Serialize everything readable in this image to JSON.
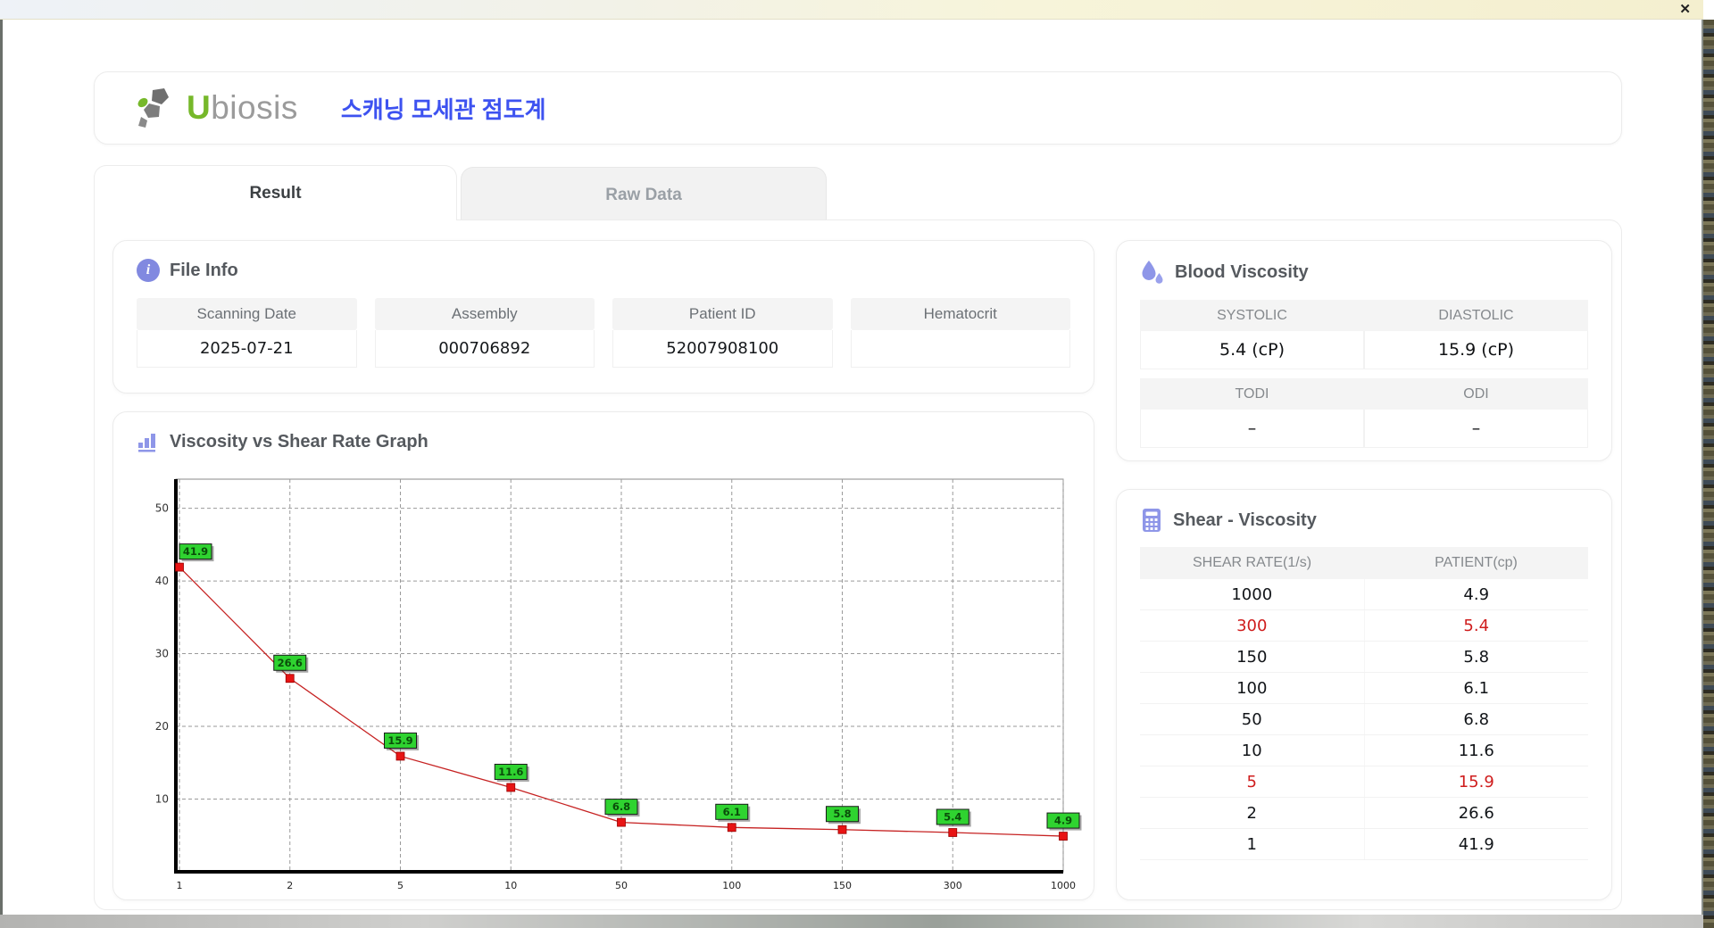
{
  "window": {
    "close_label": "✕"
  },
  "header": {
    "logo_first_letter": "U",
    "logo_rest": "biosis",
    "app_title": "스캐닝 모세관 점도계"
  },
  "tabs": {
    "result": "Result",
    "raw_data": "Raw Data"
  },
  "file_info": {
    "title": "File Info",
    "fields": [
      {
        "label": "Scanning Date",
        "value": "2025-07-21"
      },
      {
        "label": "Assembly",
        "value": "000706892"
      },
      {
        "label": "Patient ID",
        "value": "52007908100"
      },
      {
        "label": "Hematocrit",
        "value": ""
      }
    ]
  },
  "graph_section": {
    "title": "Viscosity vs Shear Rate Graph"
  },
  "blood_viscosity": {
    "title": "Blood Viscosity",
    "systolic_label": "SYSTOLIC",
    "diastolic_label": "DIASTOLIC",
    "systolic_value": "5.4 (cP)",
    "diastolic_value": "15.9 (cP)",
    "todi_label": "TODI",
    "odi_label": "ODI",
    "todi_value": "–",
    "odi_value": "–"
  },
  "shear_viscosity": {
    "title": "Shear - Viscosity",
    "col_rate": "SHEAR RATE(1/s)",
    "col_patient": "PATIENT(cp)",
    "rows": [
      {
        "rate": "1000",
        "patient": "4.9",
        "highlight": false
      },
      {
        "rate": "300",
        "patient": "5.4",
        "highlight": true
      },
      {
        "rate": "150",
        "patient": "5.8",
        "highlight": false
      },
      {
        "rate": "100",
        "patient": "6.1",
        "highlight": false
      },
      {
        "rate": "50",
        "patient": "6.8",
        "highlight": false
      },
      {
        "rate": "10",
        "patient": "11.6",
        "highlight": false
      },
      {
        "rate": "5",
        "patient": "15.9",
        "highlight": true
      },
      {
        "rate": "2",
        "patient": "26.6",
        "highlight": false
      },
      {
        "rate": "1",
        "patient": "41.9",
        "highlight": false
      }
    ]
  },
  "chart_data": {
    "type": "line",
    "title": "",
    "xlabel": "",
    "ylabel": "",
    "x_scale": "categorical",
    "categories": [
      "1",
      "2",
      "5",
      "10",
      "50",
      "100",
      "150",
      "300",
      "1000"
    ],
    "values": [
      41.9,
      26.6,
      15.9,
      11.6,
      6.8,
      6.1,
      5.8,
      5.4,
      4.9
    ],
    "point_labels": [
      "41.9",
      "26.6",
      "15.9",
      "11.6",
      "6.8",
      "6.1",
      "5.8",
      "5.4",
      "4.9"
    ],
    "y_ticks": [
      10,
      20,
      30,
      40,
      50
    ],
    "ylim": [
      0,
      54
    ],
    "grid": true,
    "line_color": "#c62222",
    "marker_color": "#e81414",
    "label_bg": "#2fd330",
    "label_text_color": "#0a4d0a"
  },
  "colors": {
    "accent_purple": "#8e96e8",
    "highlight_red": "#cf1d1d",
    "title_blue": "#3d52f0",
    "logo_green": "#76b82a"
  }
}
